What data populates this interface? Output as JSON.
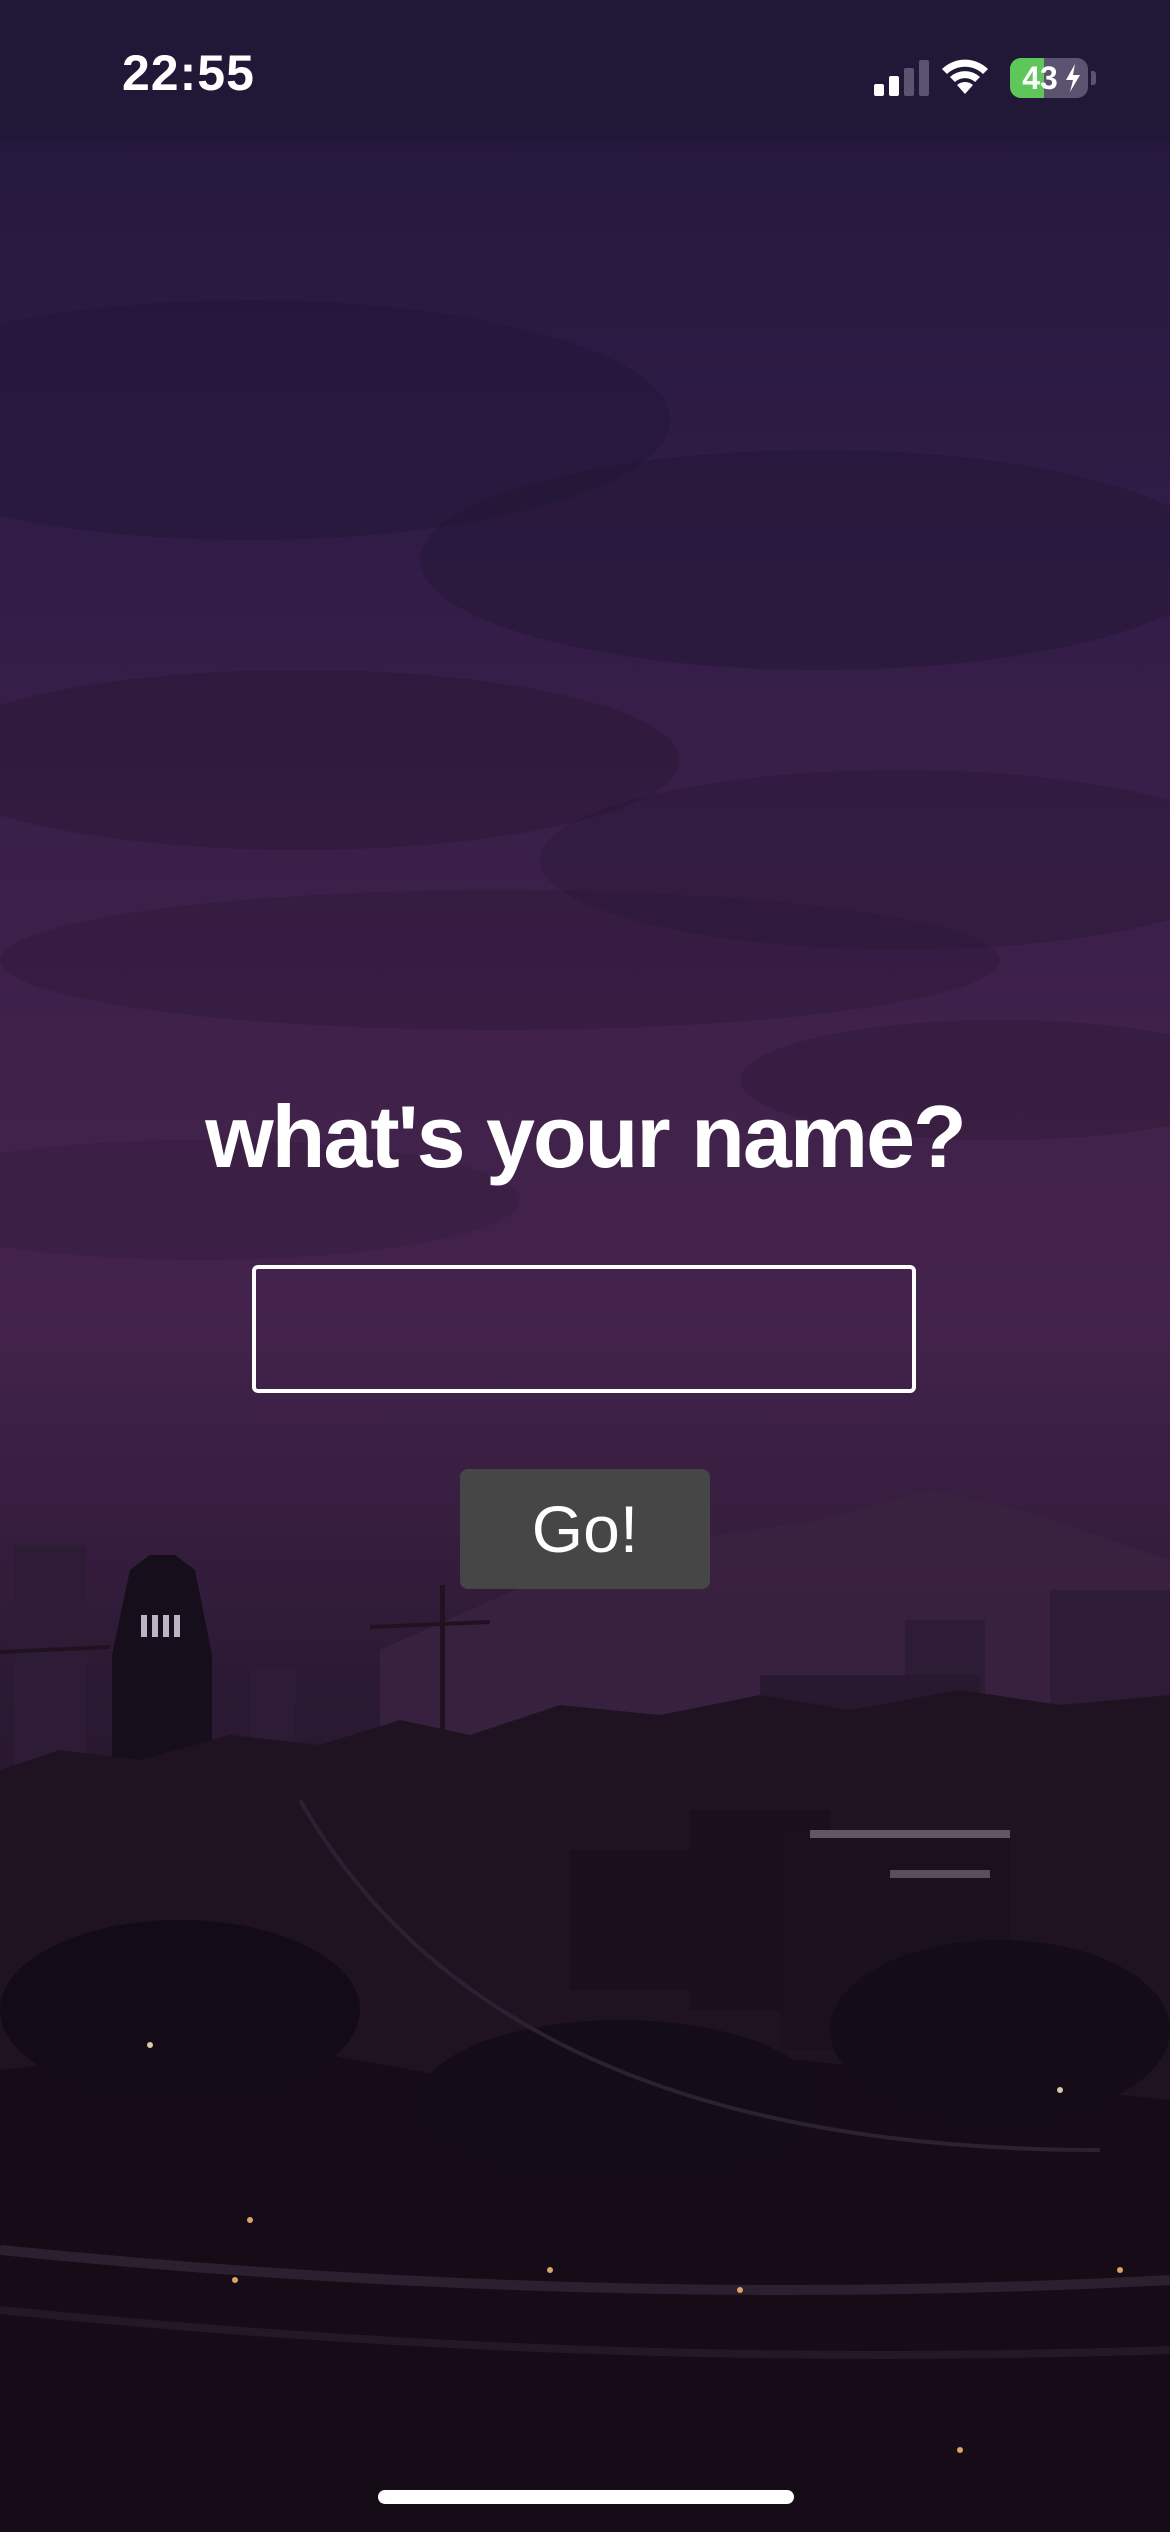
{
  "status_bar": {
    "time": "22:55",
    "battery_percent": "43",
    "battery_level": 0.43,
    "signal_bars_active": 2,
    "signal_bars_total": 4,
    "icons": [
      "cellular-signal-icon",
      "wifi-icon",
      "battery-icon",
      "charging-bolt-icon"
    ]
  },
  "main": {
    "question": "what's your name?",
    "name_input_value": "",
    "go_button_label": "Go!"
  },
  "colors": {
    "status_bar_bg": "#211838",
    "button_bg": "#464646",
    "battery_green": "#5fc75a",
    "text": "#ffffff"
  }
}
